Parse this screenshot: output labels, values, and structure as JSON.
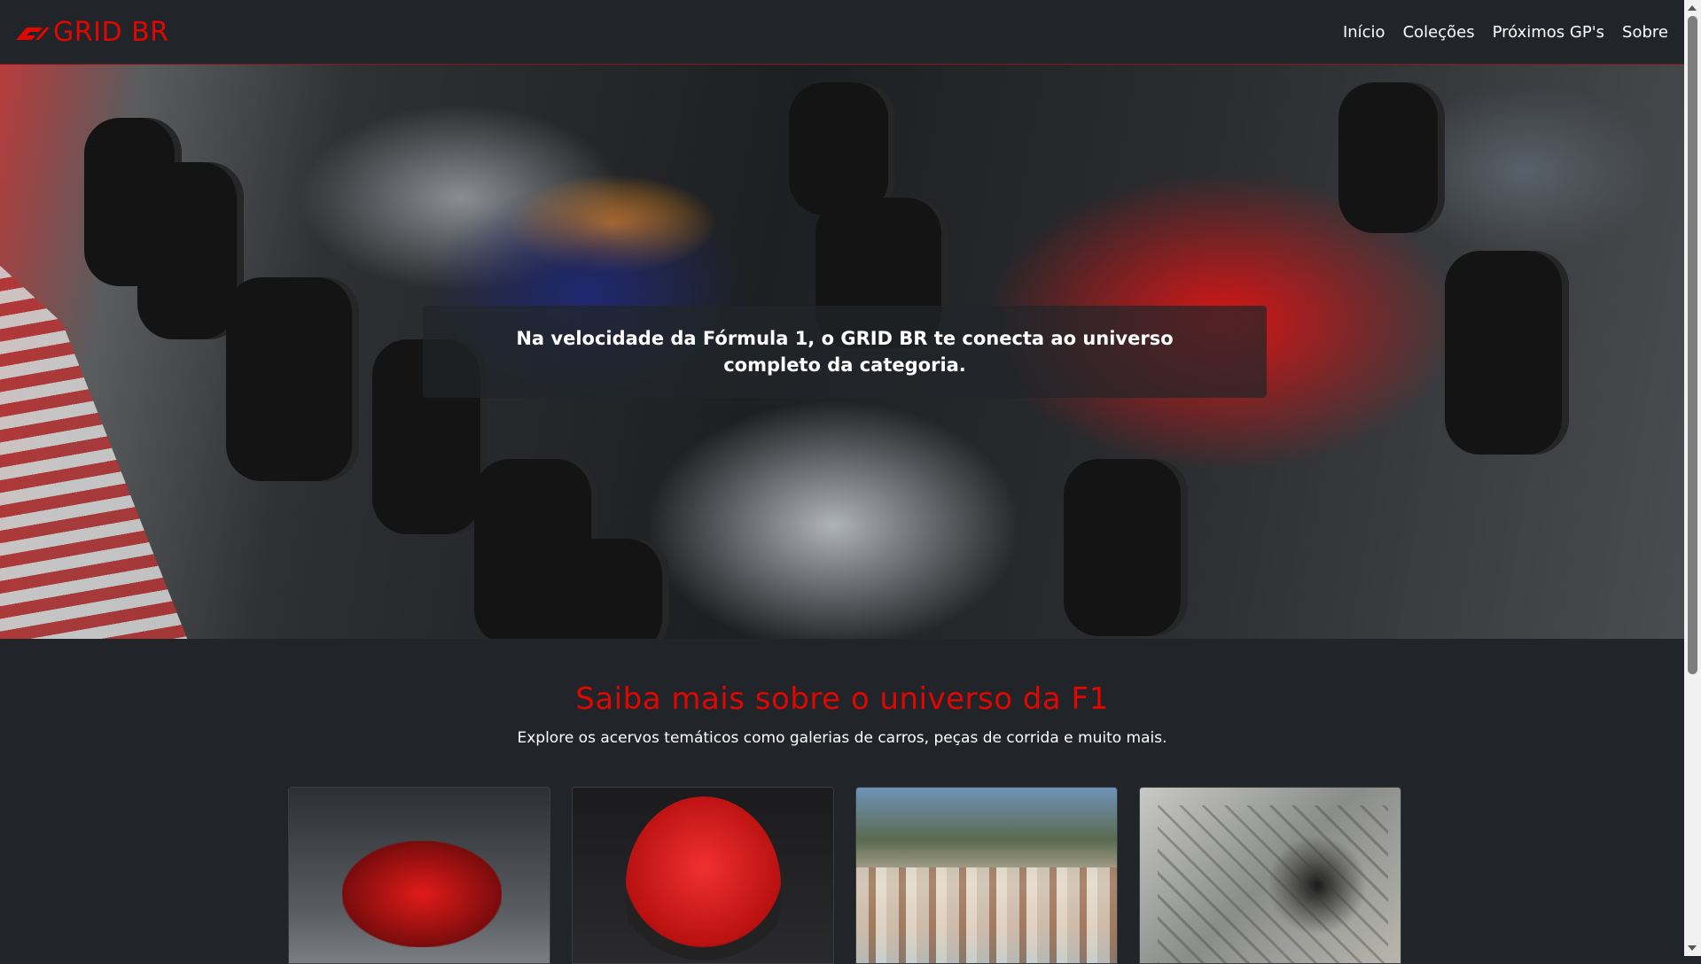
{
  "navbar": {
    "brand": "GRID BR",
    "links": [
      {
        "label": "Início"
      },
      {
        "label": "Coleções"
      },
      {
        "label": "Próximos GP's"
      },
      {
        "label": "Sobre"
      }
    ]
  },
  "hero": {
    "caption": "Na velocidade da Fórmula 1, o GRID BR te conecta ao universo completo da categoria."
  },
  "intro": {
    "title": "Saiba mais sobre o universo da F1",
    "subtitle": "Explore os acervos temáticos como galerias de carros, peças de corrida e muito mais."
  },
  "colors": {
    "accent": "#e10600",
    "background": "#212529"
  }
}
